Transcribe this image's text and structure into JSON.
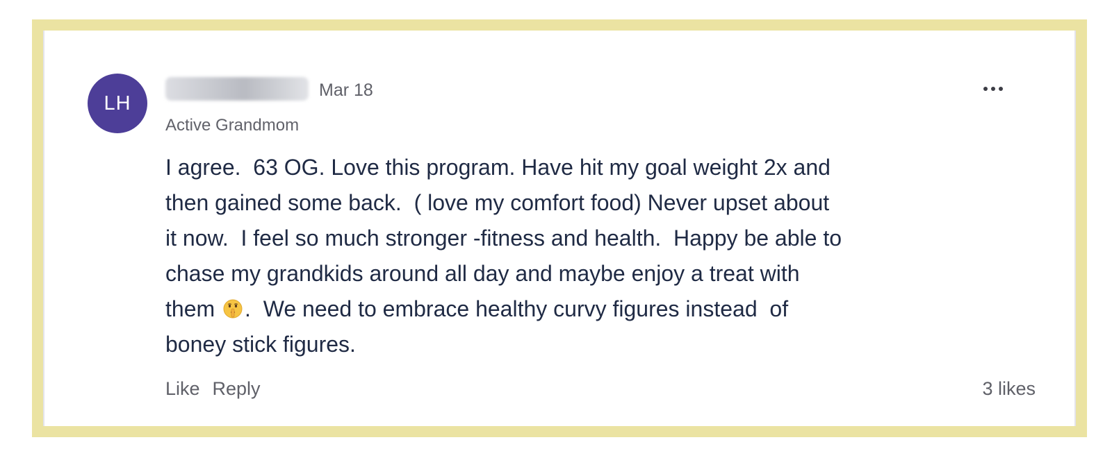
{
  "post": {
    "author_initials": "LH",
    "date": "Mar 18",
    "author_badge": "Active Grandmom",
    "body_before_emoji": "I agree.  63 OG. Love this program. Have hit my goal weight 2x and\nthen gained some back.  ( love my comfort food) Never upset about\nit now.  I feel so much stronger -fitness and health.  Happy be able to\nchase my grandkids around all day and maybe enjoy a treat with\nthem ",
    "emoji": "shushing-face-emoji",
    "body_after_emoji": ".  We need to embrace healthy curvy figures instead  of\nboney stick figures.",
    "more_icon": "more-horizontal-icon",
    "like_label": "Like",
    "reply_label": "Reply",
    "likes_count": "3 likes"
  },
  "colors": {
    "frame": "#ebe3a2",
    "avatar_bg": "#4d3e98",
    "body_text": "#1f2a44",
    "muted_text": "#5f6068"
  }
}
